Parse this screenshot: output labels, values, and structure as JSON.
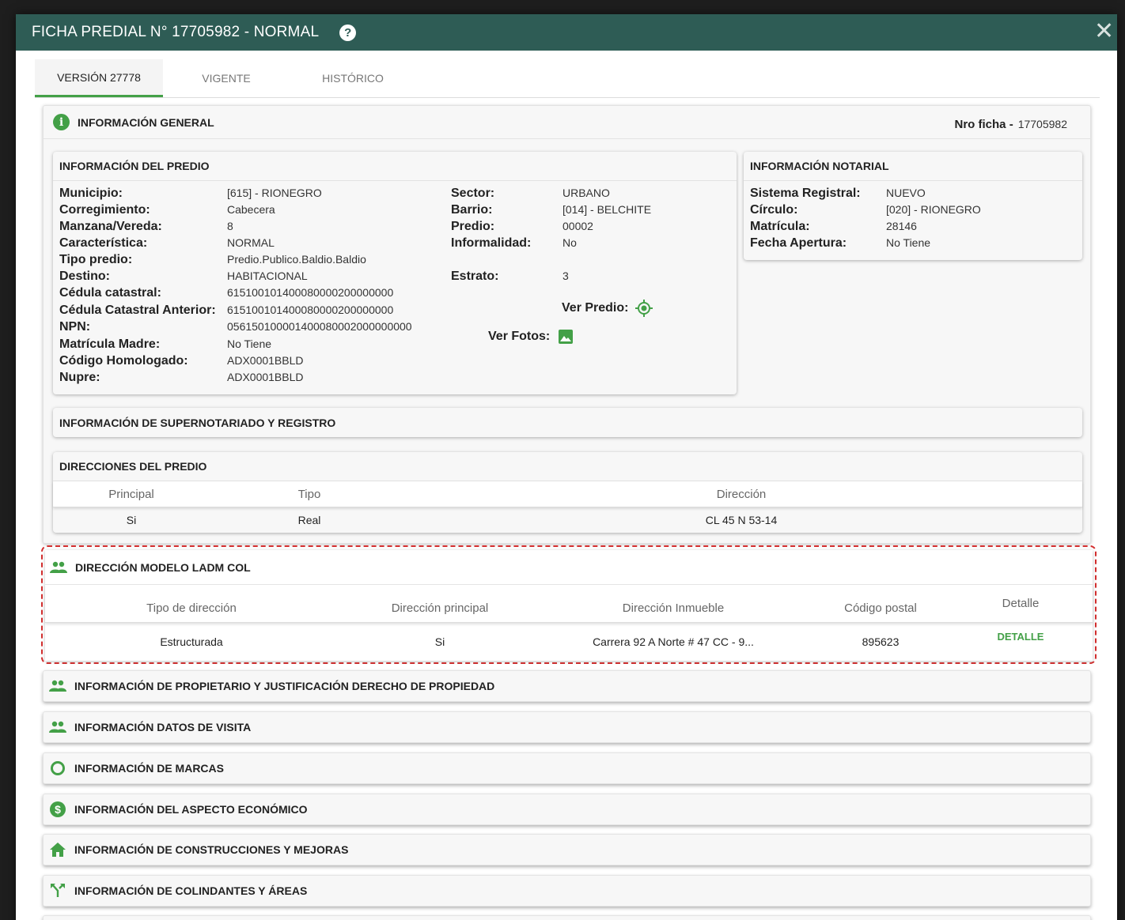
{
  "modal": {
    "title": "FICHA PREDIAL N° 17705982 - NORMAL",
    "help": "?",
    "close": "✕"
  },
  "tabs": [
    {
      "label": "VERSIÓN 27778"
    },
    {
      "label": "VIGENTE"
    },
    {
      "label": "HISTÓRICO"
    }
  ],
  "general": {
    "title": "INFORMACIÓN GENERAL",
    "nro_label": "Nro ficha -",
    "nro_value": "17705982",
    "predio": {
      "title": "INFORMACIÓN DEL PREDIO",
      "left": [
        {
          "k": "Municipio:",
          "v": "[615] - RIONEGRO"
        },
        {
          "k": "Corregimiento:",
          "v": "Cabecera"
        },
        {
          "k": "Manzana/Vereda:",
          "v": "8"
        },
        {
          "k": "Característica:",
          "v": "NORMAL"
        },
        {
          "k": "Tipo predio:",
          "v": "Predio.Publico.Baldio.Baldio"
        },
        {
          "k": "Destino:",
          "v": "HABITACIONAL"
        },
        {
          "k": "Cédula catastral:",
          "v": "615100101400080000200000000"
        },
        {
          "k": "Cédula Catastral Anterior:",
          "v": "615100101400080000200000000"
        },
        {
          "k": "NPN:",
          "v": "056150100001400080002000000000"
        },
        {
          "k": "Matrícula Madre:",
          "v": "No Tiene"
        },
        {
          "k": "Código Homologado:",
          "v": "ADX0001BBLD"
        },
        {
          "k": "Nupre:",
          "v": "ADX0001BBLD"
        }
      ],
      "right": [
        {
          "k": "Sector:",
          "v": "URBANO"
        },
        {
          "k": "Barrio:",
          "v": "[014] - BELCHITE"
        },
        {
          "k": "Predio:",
          "v": "00002"
        },
        {
          "k": "Informalidad:",
          "v": "No"
        },
        {
          "k": "Estrato:",
          "v": "3"
        }
      ],
      "ver_predio": "Ver Predio:",
      "ver_fotos": "Ver Fotos:"
    },
    "notarial": {
      "title": "INFORMACIÓN NOTARIAL",
      "rows": [
        {
          "k": "Sistema Registral:",
          "v": "NUEVO"
        },
        {
          "k": "Círculo:",
          "v": "[020] - RIONEGRO"
        },
        {
          "k": "Matrícula:",
          "v": "28146"
        },
        {
          "k": "Fecha Apertura:",
          "v": "No Tiene"
        }
      ]
    },
    "supernotariado": {
      "title": "INFORMACIÓN DE SUPERNOTARIADO Y REGISTRO"
    },
    "direcciones": {
      "title": "DIRECCIONES DEL PREDIO",
      "headers": [
        "Principal",
        "Tipo",
        "Dirección"
      ],
      "rows": [
        [
          "Si",
          "Real",
          "CL 45 N 53-14"
        ]
      ]
    }
  },
  "ladm": {
    "title": "DIRECCIÓN MODELO LADM COL",
    "headers": [
      "Tipo de dirección",
      "Dirección principal",
      "Dirección Inmueble",
      "Código postal",
      "Detalle"
    ],
    "rows": [
      [
        "Estructurada",
        "Si",
        "Carrera 92 A Norte # 47 CC - 9...",
        "895623",
        "DETALLE"
      ]
    ]
  },
  "sections": [
    {
      "title": "INFORMACIÓN DE PROPIETARIO Y JUSTIFICACIÓN DERECHO DE PROPIEDAD",
      "icon": "people-icon"
    },
    {
      "title": "INFORMACIÓN DATOS DE VISITA",
      "icon": "people-icon"
    },
    {
      "title": "INFORMACIÓN DE MARCAS",
      "icon": "ring-icon"
    },
    {
      "title": "INFORMACIÓN DEL ASPECTO ECONÓMICO",
      "icon": "dollar-icon"
    },
    {
      "title": "INFORMACIÓN DE CONSTRUCCIONES Y MEJORAS",
      "icon": "home-icon"
    },
    {
      "title": "INFORMACIÓN DE COLINDANTES Y ÁREAS",
      "icon": "merge-icon"
    }
  ],
  "colors": {
    "header": "#2e5c55",
    "accent": "#43a047",
    "highlight_border": "#d32f2f"
  }
}
